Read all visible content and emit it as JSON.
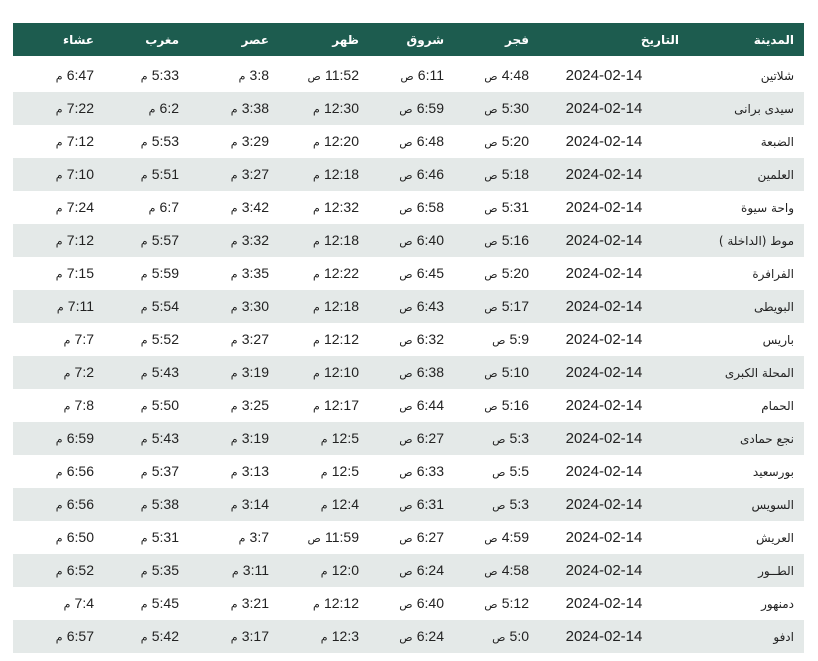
{
  "headers": [
    "المدينة",
    "التاريخ",
    "فجر",
    "شروق",
    "ظهر",
    "عصر",
    "مغرب",
    "عشاء"
  ],
  "rows": [
    {
      "city": "شلاتين",
      "date": "2024-02-14",
      "fajr": [
        "4:48",
        "ص"
      ],
      "shuruq": [
        "6:11",
        "ص"
      ],
      "dhuhr": [
        "11:52",
        "ص"
      ],
      "asr": [
        "3:8",
        "م"
      ],
      "maghrib": [
        "5:33",
        "م"
      ],
      "isha": [
        "6:47",
        "م"
      ]
    },
    {
      "city": "سيدى برانى",
      "date": "2024-02-14",
      "fajr": [
        "5:30",
        "ص"
      ],
      "shuruq": [
        "6:59",
        "ص"
      ],
      "dhuhr": [
        "12:30",
        "م"
      ],
      "asr": [
        "3:38",
        "م"
      ],
      "maghrib": [
        "6:2",
        "م"
      ],
      "isha": [
        "7:22",
        "م"
      ]
    },
    {
      "city": "الضبعة",
      "date": "2024-02-14",
      "fajr": [
        "5:20",
        "ص"
      ],
      "shuruq": [
        "6:48",
        "ص"
      ],
      "dhuhr": [
        "12:20",
        "م"
      ],
      "asr": [
        "3:29",
        "م"
      ],
      "maghrib": [
        "5:53",
        "م"
      ],
      "isha": [
        "7:12",
        "م"
      ]
    },
    {
      "city": "العلمين",
      "date": "2024-02-14",
      "fajr": [
        "5:18",
        "ص"
      ],
      "shuruq": [
        "6:46",
        "ص"
      ],
      "dhuhr": [
        "12:18",
        "م"
      ],
      "asr": [
        "3:27",
        "م"
      ],
      "maghrib": [
        "5:51",
        "م"
      ],
      "isha": [
        "7:10",
        "م"
      ]
    },
    {
      "city": "واحة سيوة",
      "date": "2024-02-14",
      "fajr": [
        "5:31",
        "ص"
      ],
      "shuruq": [
        "6:58",
        "ص"
      ],
      "dhuhr": [
        "12:32",
        "م"
      ],
      "asr": [
        "3:42",
        "م"
      ],
      "maghrib": [
        "6:7",
        "م"
      ],
      "isha": [
        "7:24",
        "م"
      ]
    },
    {
      "city": "موط (الداخلة )",
      "date": "2024-02-14",
      "fajr": [
        "5:16",
        "ص"
      ],
      "shuruq": [
        "6:40",
        "ص"
      ],
      "dhuhr": [
        "12:18",
        "م"
      ],
      "asr": [
        "3:32",
        "م"
      ],
      "maghrib": [
        "5:57",
        "م"
      ],
      "isha": [
        "7:12",
        "م"
      ]
    },
    {
      "city": "الفرافرة",
      "date": "2024-02-14",
      "fajr": [
        "5:20",
        "ص"
      ],
      "shuruq": [
        "6:45",
        "ص"
      ],
      "dhuhr": [
        "12:22",
        "م"
      ],
      "asr": [
        "3:35",
        "م"
      ],
      "maghrib": [
        "5:59",
        "م"
      ],
      "isha": [
        "7:15",
        "م"
      ]
    },
    {
      "city": "البويطى",
      "date": "2024-02-14",
      "fajr": [
        "5:17",
        "ص"
      ],
      "shuruq": [
        "6:43",
        "ص"
      ],
      "dhuhr": [
        "12:18",
        "م"
      ],
      "asr": [
        "3:30",
        "م"
      ],
      "maghrib": [
        "5:54",
        "م"
      ],
      "isha": [
        "7:11",
        "م"
      ]
    },
    {
      "city": "باريس",
      "date": "2024-02-14",
      "fajr": [
        "5:9",
        "ص"
      ],
      "shuruq": [
        "6:32",
        "ص"
      ],
      "dhuhr": [
        "12:12",
        "م"
      ],
      "asr": [
        "3:27",
        "م"
      ],
      "maghrib": [
        "5:52",
        "م"
      ],
      "isha": [
        "7:7",
        "م"
      ]
    },
    {
      "city": "المحلة الكبرى",
      "date": "2024-02-14",
      "fajr": [
        "5:10",
        "ص"
      ],
      "shuruq": [
        "6:38",
        "ص"
      ],
      "dhuhr": [
        "12:10",
        "م"
      ],
      "asr": [
        "3:19",
        "م"
      ],
      "maghrib": [
        "5:43",
        "م"
      ],
      "isha": [
        "7:2",
        "م"
      ]
    },
    {
      "city": "الحمام",
      "date": "2024-02-14",
      "fajr": [
        "5:16",
        "ص"
      ],
      "shuruq": [
        "6:44",
        "ص"
      ],
      "dhuhr": [
        "12:17",
        "م"
      ],
      "asr": [
        "3:25",
        "م"
      ],
      "maghrib": [
        "5:50",
        "م"
      ],
      "isha": [
        "7:8",
        "م"
      ]
    },
    {
      "city": "نجع حمادى",
      "date": "2024-02-14",
      "fajr": [
        "5:3",
        "ص"
      ],
      "shuruq": [
        "6:27",
        "ص"
      ],
      "dhuhr": [
        "12:5",
        "م"
      ],
      "asr": [
        "3:19",
        "م"
      ],
      "maghrib": [
        "5:43",
        "م"
      ],
      "isha": [
        "6:59",
        "م"
      ]
    },
    {
      "city": "بورسعيد",
      "date": "2024-02-14",
      "fajr": [
        "5:5",
        "ص"
      ],
      "shuruq": [
        "6:33",
        "ص"
      ],
      "dhuhr": [
        "12:5",
        "م"
      ],
      "asr": [
        "3:13",
        "م"
      ],
      "maghrib": [
        "5:37",
        "م"
      ],
      "isha": [
        "6:56",
        "م"
      ]
    },
    {
      "city": "السويس",
      "date": "2024-02-14",
      "fajr": [
        "5:3",
        "ص"
      ],
      "shuruq": [
        "6:31",
        "ص"
      ],
      "dhuhr": [
        "12:4",
        "م"
      ],
      "asr": [
        "3:14",
        "م"
      ],
      "maghrib": [
        "5:38",
        "م"
      ],
      "isha": [
        "6:56",
        "م"
      ]
    },
    {
      "city": "العريش",
      "date": "2024-02-14",
      "fajr": [
        "4:59",
        "ص"
      ],
      "shuruq": [
        "6:27",
        "ص"
      ],
      "dhuhr": [
        "11:59",
        "ص"
      ],
      "asr": [
        "3:7",
        "م"
      ],
      "maghrib": [
        "5:31",
        "م"
      ],
      "isha": [
        "6:50",
        "م"
      ]
    },
    {
      "city": "الطــور",
      "date": "2024-02-14",
      "fajr": [
        "4:58",
        "ص"
      ],
      "shuruq": [
        "6:24",
        "ص"
      ],
      "dhuhr": [
        "12:0",
        "م"
      ],
      "asr": [
        "3:11",
        "م"
      ],
      "maghrib": [
        "5:35",
        "م"
      ],
      "isha": [
        "6:52",
        "م"
      ]
    },
    {
      "city": "دمنهور",
      "date": "2024-02-14",
      "fajr": [
        "5:12",
        "ص"
      ],
      "shuruq": [
        "6:40",
        "ص"
      ],
      "dhuhr": [
        "12:12",
        "م"
      ],
      "asr": [
        "3:21",
        "م"
      ],
      "maghrib": [
        "5:45",
        "م"
      ],
      "isha": [
        "7:4",
        "م"
      ]
    },
    {
      "city": "ادفو",
      "date": "2024-02-14",
      "fajr": [
        "5:0",
        "ص"
      ],
      "shuruq": [
        "6:24",
        "ص"
      ],
      "dhuhr": [
        "12:3",
        "م"
      ],
      "asr": [
        "3:17",
        "م"
      ],
      "maghrib": [
        "5:42",
        "م"
      ],
      "isha": [
        "6:57",
        "م"
      ]
    }
  ]
}
